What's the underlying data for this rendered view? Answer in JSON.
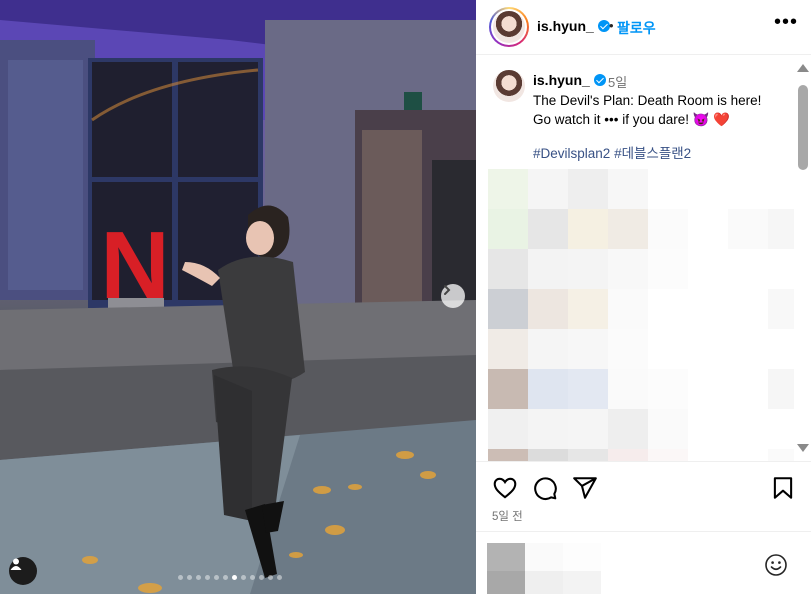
{
  "post": {
    "username": "is.hyun_",
    "separator": "•",
    "follow_label": "팔로우",
    "more_label": "•••",
    "caption_time": "5일",
    "caption_line1": "The Devil's Plan: Death Room is here!",
    "caption_line2": "Go watch it ••• if you dare! 😈 ❤️",
    "hashtags": [
      "#Devilsplan2",
      "#데블스플랜2"
    ],
    "date_label": "5일 전",
    "carousel_dots": 12,
    "active_dot": 6
  },
  "media": {
    "logo_letter": "N",
    "description_colors": {
      "accent": "#d81f26",
      "wall": "#5d5a78",
      "floor": "#5a5c62"
    }
  },
  "colors": {
    "link": "#0095f6",
    "hashtag": "#385185",
    "muted": "#737373"
  },
  "icons": [
    "heart-icon",
    "comment-icon",
    "share-icon",
    "bookmark-icon",
    "chevron-right-icon",
    "user-tag-icon",
    "emoji-icon",
    "verified-icon",
    "more-icon"
  ]
}
